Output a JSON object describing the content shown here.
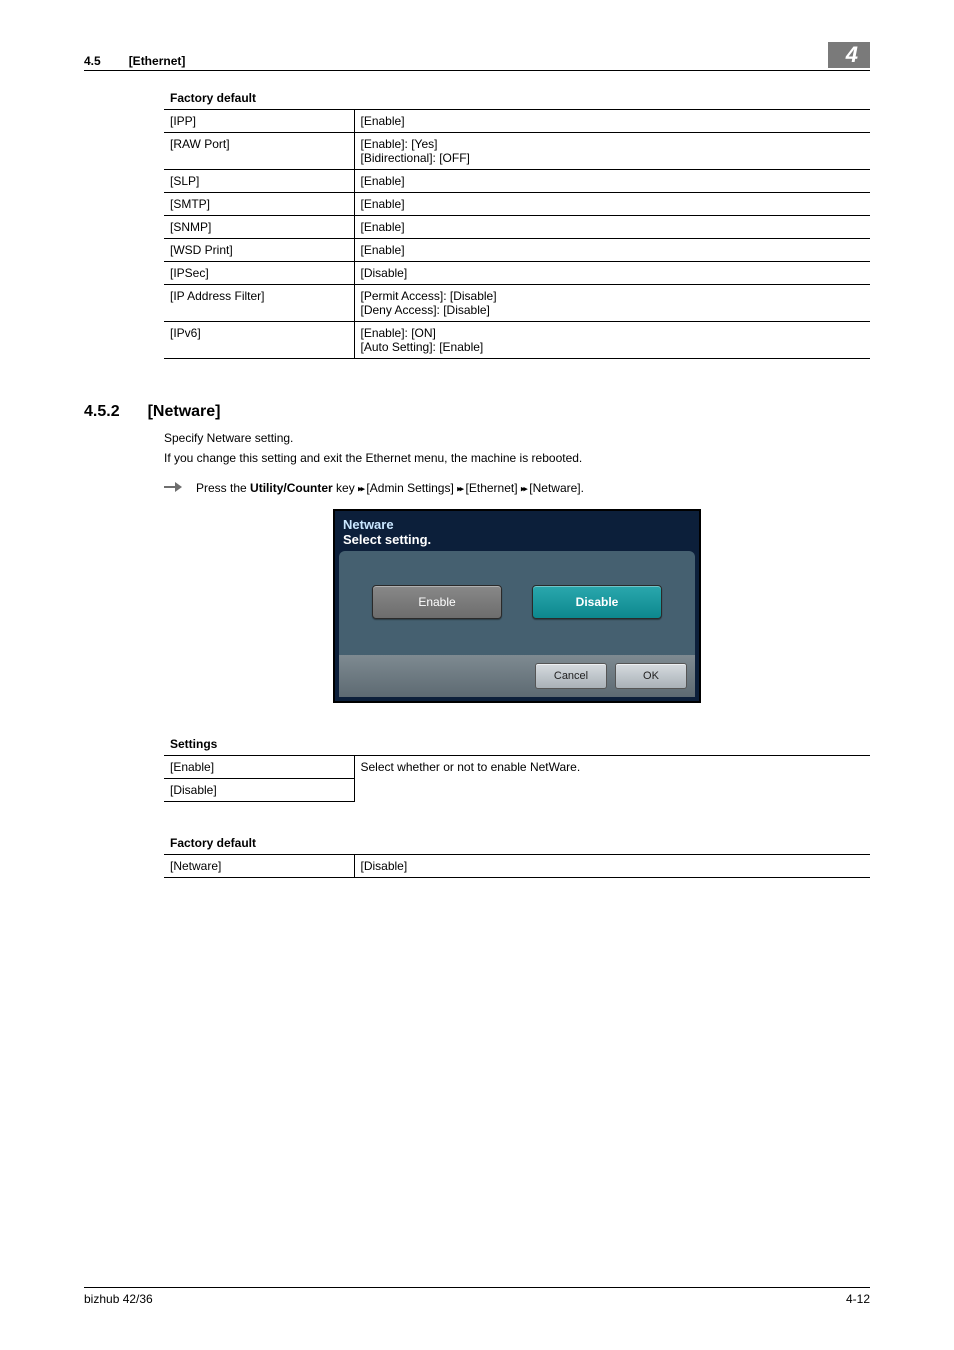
{
  "header": {
    "section_num": "4.5",
    "section_title": "[Ethernet]",
    "chapter_badge": "4"
  },
  "factory_default_1": {
    "caption": "Factory default",
    "rows": [
      {
        "key": "[IPP]",
        "val": "[Enable]"
      },
      {
        "key": "[RAW Port]",
        "val": "[Enable]: [Yes]\n[Bidirectional]: [OFF]"
      },
      {
        "key": "[SLP]",
        "val": "[Enable]"
      },
      {
        "key": "[SMTP]",
        "val": "[Enable]"
      },
      {
        "key": "[SNMP]",
        "val": "[Enable]"
      },
      {
        "key": "[WSD Print]",
        "val": "[Enable]"
      },
      {
        "key": "[IPSec]",
        "val": "[Disable]"
      },
      {
        "key": "[IP Address Filter]",
        "val": "[Permit Access]: [Disable]\n[Deny Access]: [Disable]"
      },
      {
        "key": "[IPv6]",
        "val": "[Enable]: [ON]\n[Auto Setting]: [Enable]"
      }
    ]
  },
  "section_452": {
    "num": "4.5.2",
    "title": "[Netware]",
    "para1": "Specify Netware setting.",
    "para2": "If you change this setting and exit the Ethernet menu, the machine is rebooted.",
    "step_prefix": "Press the ",
    "step_bold": "Utility/Counter",
    "step_rest1": " key ",
    "step_path1": " [Admin Settings] ",
    "step_path2": " [Ethernet] ",
    "step_path3": " [Netware]."
  },
  "device": {
    "title": "Netware",
    "subtitle": "Select setting.",
    "btn_enable": "Enable",
    "btn_disable": "Disable",
    "btn_cancel": "Cancel",
    "btn_ok": "OK"
  },
  "settings_table": {
    "caption": "Settings",
    "rows": [
      {
        "key": "[Enable]",
        "val": "Select whether or not to enable NetWare."
      },
      {
        "key": "[Disable]",
        "val": ""
      }
    ]
  },
  "factory_default_2": {
    "caption": "Factory default",
    "rows": [
      {
        "key": "[Netware]",
        "val": "[Disable]"
      }
    ]
  },
  "footer": {
    "left": "bizhub 42/36",
    "right": "4-12"
  }
}
